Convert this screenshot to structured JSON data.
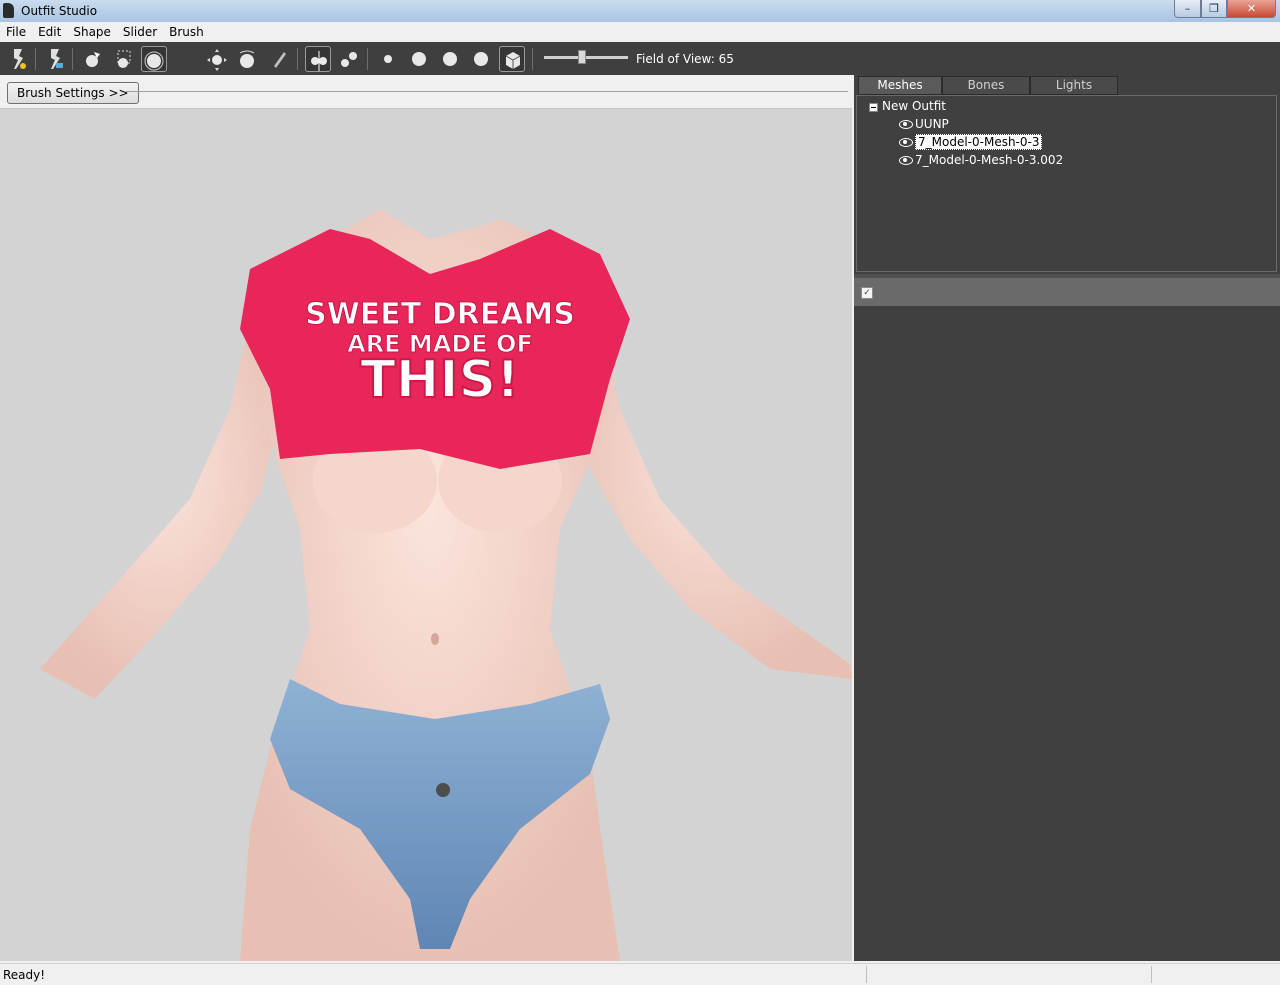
{
  "window": {
    "title": "Outfit Studio",
    "controls": {
      "minimize": "–",
      "maximize": "❐",
      "close": "✕"
    }
  },
  "menu": [
    "File",
    "Edit",
    "Shape",
    "Slider",
    "Brush"
  ],
  "toolbar": {
    "field_of_view_label": "Field of View: 65",
    "field_of_view_level": 0.45,
    "tools": [
      {
        "name": "select-tool",
        "active": false
      },
      {
        "name": "inflate-brush",
        "active": false
      },
      {
        "name": "mask-brush",
        "active": true
      },
      {
        "name": "deflate-brush",
        "active": false
      },
      {
        "name": "move-brush",
        "active": false
      },
      {
        "name": "smooth-brush",
        "active": false
      },
      {
        "name": "weight-brush",
        "active": false
      },
      {
        "name": "xmirror-toggle",
        "active": true
      },
      {
        "name": "connected-toggle",
        "active": false
      },
      {
        "name": "view-front",
        "active": false
      },
      {
        "name": "view-left",
        "active": false
      },
      {
        "name": "view-right",
        "active": false
      },
      {
        "name": "view-back",
        "active": false
      },
      {
        "name": "perspective-toggle",
        "active": true
      }
    ]
  },
  "brush_settings_label": "Brush Settings >>",
  "viewport": {
    "shirt_text_line1": "SWEET DREAMS",
    "shirt_text_line2": "ARE MADE OF",
    "shirt_text_line3": "THIS!"
  },
  "right_panel": {
    "tabs": [
      {
        "label": "Meshes",
        "active": true
      },
      {
        "label": "Bones",
        "active": false
      },
      {
        "label": "Lights",
        "active": false
      }
    ],
    "tree": {
      "root": "New Outfit",
      "items": [
        {
          "label": "UUNP",
          "selected": false
        },
        {
          "label": "7_Model-0-Mesh-0-3",
          "selected": true
        },
        {
          "label": "7_Model-0-Mesh-0-3.002",
          "selected": false
        }
      ]
    },
    "sliders_checkbox": "✓"
  },
  "status": {
    "text": "Ready!"
  },
  "colors": {
    "toolbar_bg": "#3f3f3f",
    "panel_bg": "#404040",
    "viewport_bg": "#d3d3d3",
    "shirt": "#e8265a",
    "jeans": "#7fa2c8",
    "skin": "#f2d2c8"
  }
}
